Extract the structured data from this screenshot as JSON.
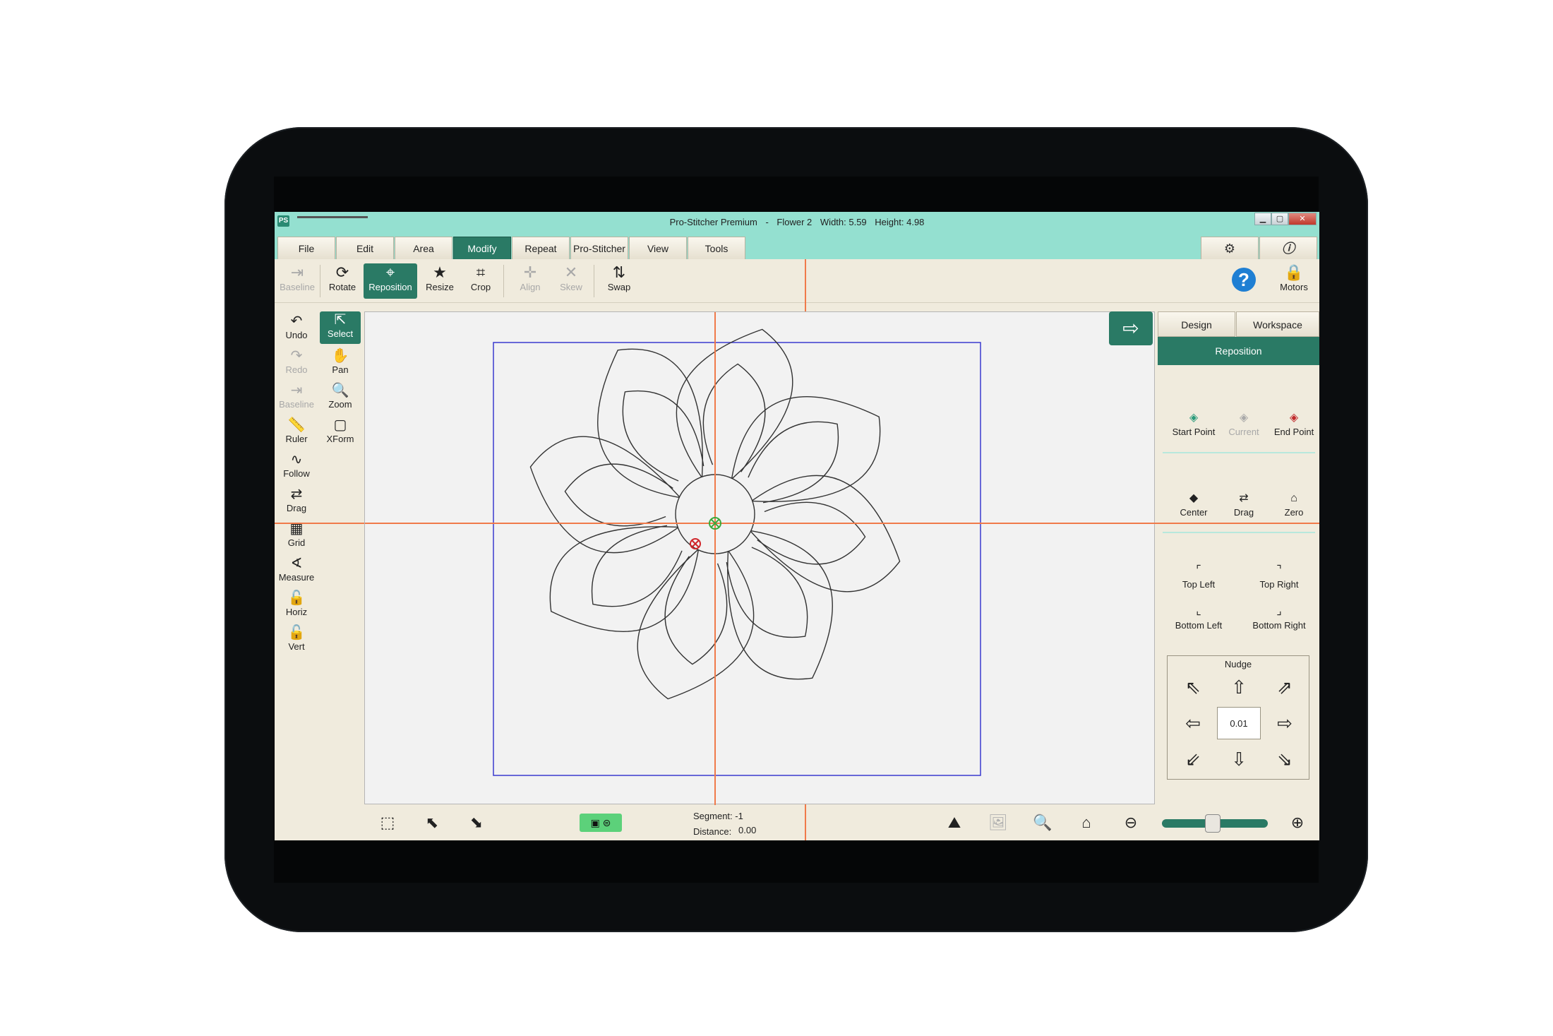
{
  "window": {
    "app_name": "Pro-Stitcher Premium",
    "separator": "-",
    "design_name": "Flower 2",
    "width_text": "Width: 5.59",
    "height_text": "Height: 4.98",
    "app_icon": "PS"
  },
  "menu": {
    "tabs": [
      "File",
      "Edit",
      "Area",
      "Modify",
      "Repeat",
      "Pro-Stitcher",
      "View",
      "Tools"
    ],
    "active": "Modify",
    "settings_icon": "gear-icon",
    "info_icon": "info-icon"
  },
  "ribbon": {
    "baseline": "Baseline",
    "rotate": "Rotate",
    "reposition": "Reposition",
    "resize": "Resize",
    "crop": "Crop",
    "align": "Align",
    "skew": "Skew",
    "swap": "Swap",
    "motors": "Motors"
  },
  "left_tools": {
    "undo": "Undo",
    "redo": "Redo",
    "baseline": "Baseline",
    "ruler": "Ruler",
    "follow": "Follow",
    "drag": "Drag",
    "grid": "Grid",
    "measure": "Measure",
    "horiz": "Horiz",
    "vert": "Vert",
    "select": "Select",
    "pan": "Pan",
    "zoom": "Zoom",
    "xform": "XForm"
  },
  "right_panel": {
    "tab_design": "Design",
    "tab_workspace": "Workspace",
    "header": "Reposition",
    "start_point": "Start Point",
    "current": "Current",
    "end_point": "End Point",
    "center": "Center",
    "drag": "Drag",
    "zero": "Zero",
    "top_left": "Top Left",
    "top_right": "Top Right",
    "bottom_left": "Bottom Left",
    "bottom_right": "Bottom Right",
    "nudge_title": "Nudge",
    "nudge_value": "0.01"
  },
  "status": {
    "segment": "Segment: -1",
    "distance_label": "Distance:",
    "distance_value": "0.00"
  },
  "colors": {
    "accent": "#2a7a65",
    "title_bg": "#94e0d0",
    "crosshair": "#f07a4a",
    "bounding_box": "#3a3ad0"
  }
}
